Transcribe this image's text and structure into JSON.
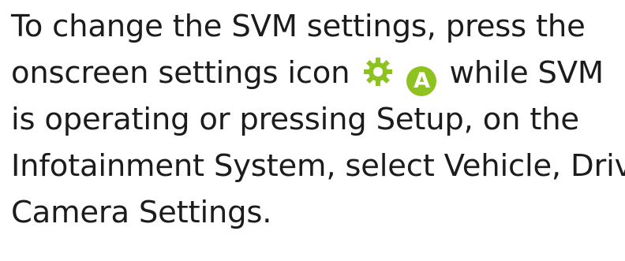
{
  "paragraph": {
    "line1": "To change the SVM settings, press the",
    "line2_before_icons": "onscreen settings icon",
    "line2_after_icons": "while SVM",
    "line3": "is operating or pressing Setup, on the",
    "line4": "Infotainment System, select Vehicle, Drive",
    "line5": "Camera Settings."
  },
  "icons": {
    "settings_icon": "gear-icon",
    "settings_icon_color": "#8ec31f",
    "callout_label": "A",
    "callout_color": "#8ec31f"
  }
}
